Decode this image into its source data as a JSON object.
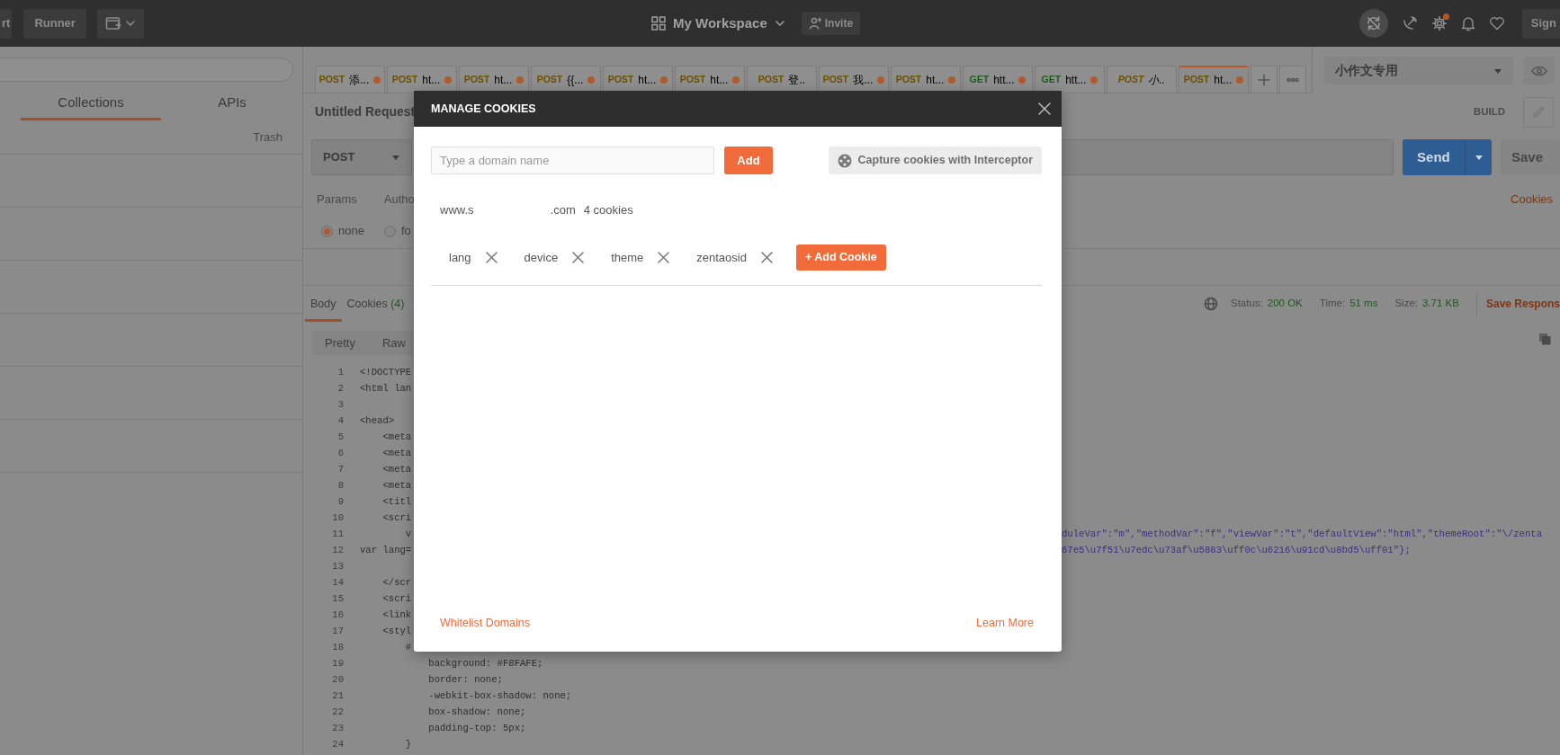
{
  "top_bar": {
    "buttons": [
      {
        "label": "rt"
      },
      {
        "label": "Runner"
      }
    ],
    "workspace": "My Workspace",
    "invite": "Invite",
    "settings_badge": true,
    "sign_in": "Sign"
  },
  "sidebar": {
    "tabs": [
      {
        "label": "Collections",
        "selected": true
      },
      {
        "label": "APIs",
        "selected": false
      }
    ],
    "trash": "Trash"
  },
  "request_tabs": [
    {
      "method": "POST",
      "color": "#6b5000",
      "title": "添...",
      "unsaved": true,
      "preview": false,
      "selected": false
    },
    {
      "method": "POST",
      "color": "#6b5000",
      "title": "ht...",
      "unsaved": true,
      "preview": false,
      "selected": false
    },
    {
      "method": "POST",
      "color": "#6b5000",
      "title": "ht...",
      "unsaved": true,
      "preview": false,
      "selected": false
    },
    {
      "method": "POST",
      "color": "#6b5000",
      "title": "{{...",
      "unsaved": true,
      "preview": false,
      "selected": false
    },
    {
      "method": "POST",
      "color": "#6b5000",
      "title": "ht...",
      "unsaved": true,
      "preview": false,
      "selected": false
    },
    {
      "method": "POST",
      "color": "#6b5000",
      "title": "ht...",
      "unsaved": true,
      "preview": false,
      "selected": false
    },
    {
      "method": "POST",
      "color": "#6b5000",
      "title": "登..",
      "unsaved": false,
      "preview": false,
      "selected": false
    },
    {
      "method": "POST",
      "color": "#6b5000",
      "title": "我...",
      "unsaved": true,
      "preview": false,
      "selected": false
    },
    {
      "method": "POST",
      "color": "#6b5000",
      "title": "ht...",
      "unsaved": true,
      "preview": false,
      "selected": false
    },
    {
      "method": "GET",
      "color": "#1f5a1f",
      "title": "htt...",
      "unsaved": true,
      "preview": false,
      "selected": false
    },
    {
      "method": "GET",
      "color": "#1f5a1f",
      "title": "htt...",
      "unsaved": true,
      "preview": false,
      "selected": false
    },
    {
      "method": "POST",
      "color": "#6b5000",
      "title": "小..",
      "unsaved": false,
      "preview": true,
      "selected": false
    },
    {
      "method": "POST",
      "color": "#6b5000",
      "title": "ht...",
      "unsaved": true,
      "preview": false,
      "selected": true
    }
  ],
  "environment": {
    "name": "小作文专用"
  },
  "request": {
    "title": "Untitled Request",
    "build": "BUILD",
    "method": "POST",
    "send": "Send",
    "save": "Save",
    "tabs": [
      {
        "label": "Params"
      },
      {
        "label": "Autho"
      }
    ],
    "cookies_link": "Cookies",
    "body_types": [
      {
        "label": "none",
        "selected": true
      },
      {
        "label": "fo",
        "selected": false
      }
    ]
  },
  "response": {
    "tabs": [
      {
        "label": "Body",
        "selected": true
      },
      {
        "label": "Cookies",
        "count": "(4)",
        "selected": false
      }
    ],
    "status_label": "Status:",
    "status": "200 OK",
    "time_label": "Time:",
    "time": "51 ms",
    "size_label": "Size:",
    "size": "3.71 KB",
    "save": "Save Respons",
    "views": [
      {
        "label": "Pretty"
      },
      {
        "label": "Raw"
      }
    ],
    "code_lines": [
      {
        "number": "1",
        "text": "<!DOCTYPE"
      },
      {
        "number": "2",
        "text": "<html lan"
      },
      {
        "number": "3"
      },
      {
        "number": "4",
        "text": "<head>"
      },
      {
        "number": "5",
        "text": "    <meta"
      },
      {
        "number": "6",
        "text": "    <meta"
      },
      {
        "number": "7",
        "text": "    <meta"
      },
      {
        "number": "8",
        "text": "    <meta"
      },
      {
        "number": "9",
        "text": "    <titl"
      },
      {
        "number": "10",
        "text": "    <scri"
      },
      {
        "number": "11",
        "text": "        v",
        "tail": "duleVar\":\"m\",\"methodVar\":\"f\",\"viewVar\":\"t\",\"defaultView\":\"html\",\"themeRoot\":\"\\/zenta"
      },
      {
        "number": "12",
        "text": "var lang=",
        "tail": "67e5\\u7f51\\u7edc\\u73af\\u5883\\uff0c\\u6216\\u91cd\\u8bd5\\uff01\"};"
      },
      {
        "number": "13"
      },
      {
        "number": "14",
        "text": "    </scr"
      },
      {
        "number": "15",
        "text": "    <scri"
      },
      {
        "number": "16",
        "text": "    <link"
      },
      {
        "number": "17",
        "text": "    <styl"
      },
      {
        "number": "18",
        "text": "        #"
      },
      {
        "number": "19",
        "text": "            background: #F8FAFE;"
      },
      {
        "number": "20",
        "text": "            border: none;"
      },
      {
        "number": "21",
        "text": "            -webkit-box-shadow: none;"
      },
      {
        "number": "22",
        "text": "            box-shadow: none;"
      },
      {
        "number": "23",
        "text": "            padding-top: 5px;"
      },
      {
        "number": "24",
        "text": "        }"
      }
    ]
  },
  "modal": {
    "title": "MANAGE COOKIES",
    "domain_placeholder": "Type a domain name",
    "add": "Add",
    "capture": "Capture cookies with Interceptor",
    "domain": {
      "start": "www.s",
      "end": ".com",
      "count": "4 cookies",
      "cookies": [
        {
          "name": "lang"
        },
        {
          "name": "device"
        },
        {
          "name": "theme"
        },
        {
          "name": "zentaosid"
        }
      ]
    },
    "add_cookie": "+ Add Cookie",
    "whitelist": "Whitelist Domains",
    "learn_more": "Learn More"
  }
}
